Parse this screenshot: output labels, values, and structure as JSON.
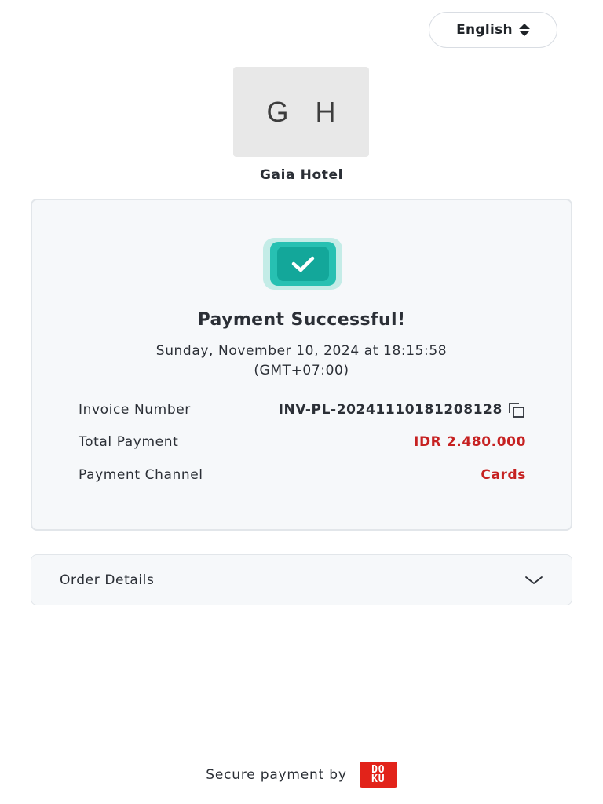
{
  "language_selector": {
    "label": "English",
    "icon": "sort-arrows-icon"
  },
  "merchant": {
    "logo_initials": "G H",
    "name": "Gaia Hotel"
  },
  "status": {
    "icon": "check-icon",
    "title": "Payment Successful!",
    "date_line1": "Sunday, November 10, 2024 at 18:15:58",
    "date_line2": "(GMT+07:00)"
  },
  "details": {
    "invoice_label": "Invoice Number",
    "invoice_value": "INV-PL-20241110181208128",
    "total_label": "Total Payment",
    "total_value": "IDR 2.480.000",
    "channel_label": "Payment Channel",
    "channel_value": "Cards"
  },
  "order_details": {
    "label": "Order Details",
    "icon": "chevron-down-icon"
  },
  "footer": {
    "text": "Secure payment by",
    "brand_top": "DO",
    "brand_bottom": "KU"
  },
  "colors": {
    "accent_teal": "#13a79a",
    "amount_red": "#c62121",
    "brand_red": "#e2231a"
  }
}
